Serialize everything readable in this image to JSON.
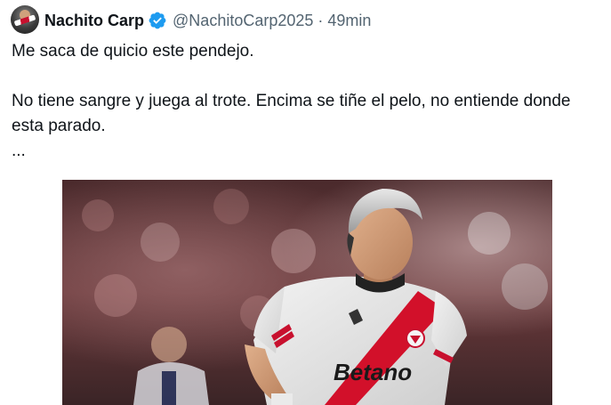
{
  "author": {
    "display_name": "Nachito Carp",
    "handle": "@NachitoCarp2025",
    "separator": "·",
    "time": "49min",
    "verified_color": "#1d9bf0"
  },
  "tweet": {
    "line1": "Me saca de quicio este pendejo.",
    "line2": "No tiene sangre y juega al trote. Encima se tiñe el pelo, no entiende donde esta parado.",
    "line3": "..."
  },
  "media": {
    "jersey_sponsor": "Betano"
  }
}
